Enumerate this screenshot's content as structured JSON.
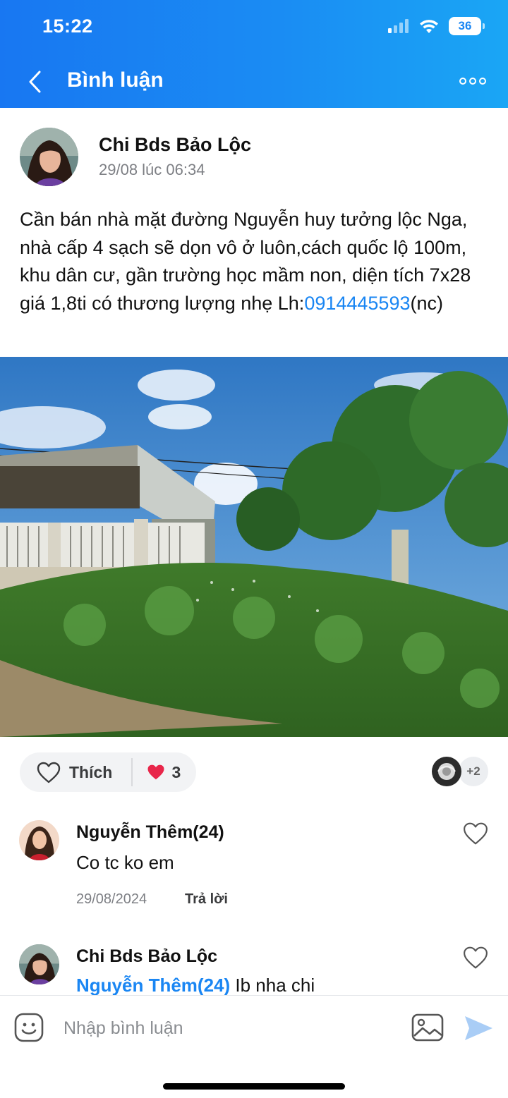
{
  "status_bar": {
    "time": "15:22",
    "battery": "36"
  },
  "nav": {
    "title": "Bình luận"
  },
  "post": {
    "author": "Chi Bds Bảo Lộc",
    "time": "29/08 lúc 06:34",
    "text": "Cần bán nhà mặt đường Nguyễn huy tưởng lộc Nga, nhà cấp 4 sạch sẽ dọn vô ở luôn,cách quốc lộ 100m, khu dân cư, gần trường học mầm non, diện tích 7x28 giá 1,8ti có thương lượng nhẹ Lh:",
    "phone": "0914445593",
    "text_suffix": "(nc)"
  },
  "reactions": {
    "like_label": "Thích",
    "heart_count": "3",
    "viewers_more": "+2"
  },
  "comments": [
    {
      "author": "Nguyễn Thêm(24)",
      "text": "Co tc ko em",
      "date": "29/08/2024",
      "reply_label": "Trả lời"
    },
    {
      "author": "Chi Bds Bảo Lộc",
      "mention": "Nguyễn Thêm(24)",
      "text": " Ib nha chi"
    }
  ],
  "composer": {
    "placeholder": "Nhập bình luận"
  },
  "colors": {
    "accent": "#1a86f3",
    "header_start": "#1877f2",
    "header_end": "#1aa6f5",
    "heart": "#e8264a"
  }
}
